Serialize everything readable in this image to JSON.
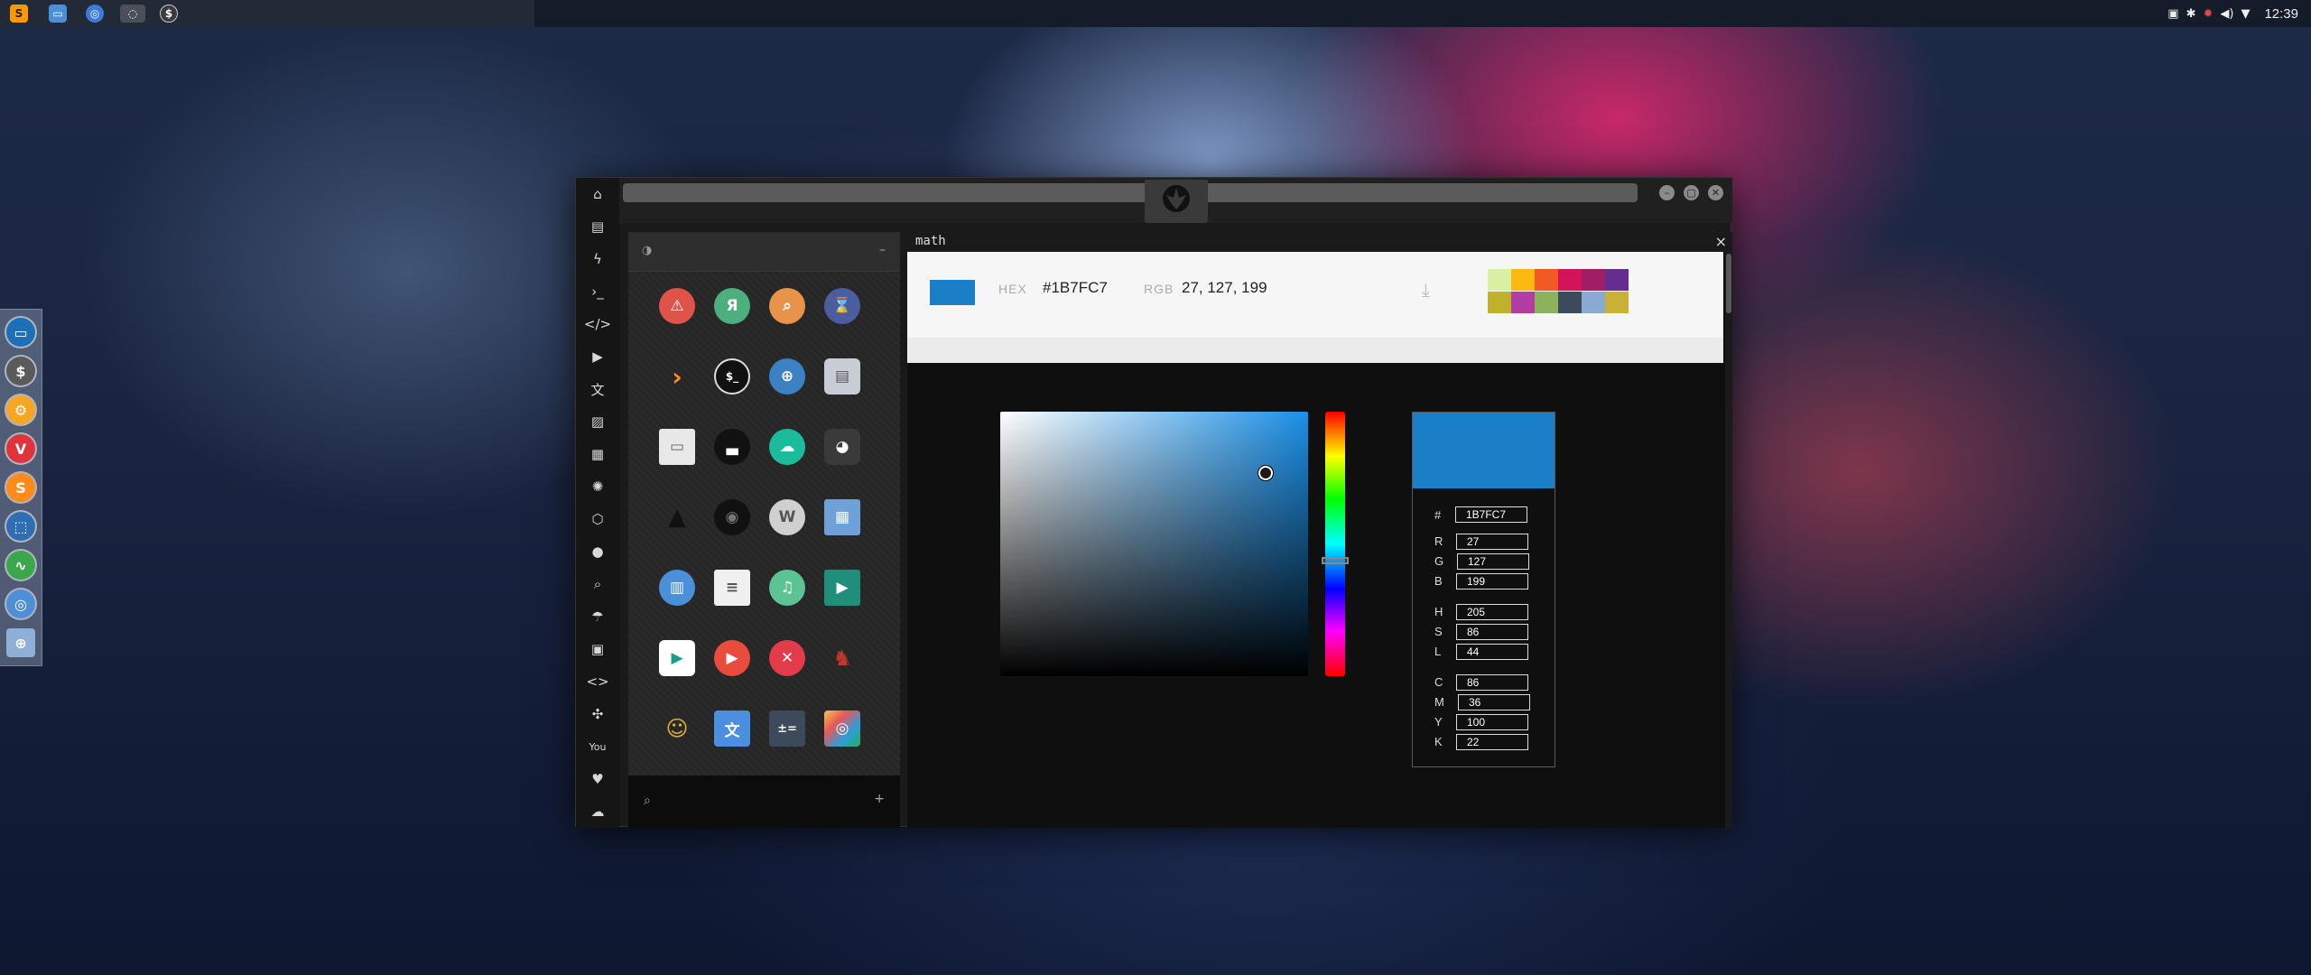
{
  "topbar": {
    "clock": "12:39",
    "taskbar_icons": [
      "sublime-text-icon",
      "file-manager-icon",
      "chromium-icon",
      "app-icon",
      "terminal-icon"
    ]
  },
  "dock": {
    "icons": [
      "files-icon",
      "dollar-terminal-icon",
      "settings-icon",
      "vivaldi-icon",
      "sublime-icon",
      "screenshot-icon",
      "system-monitor-icon",
      "chrome-icon",
      "globe-icon"
    ]
  },
  "window": {
    "tab_title": "math",
    "close_glyph": "×",
    "apps_panel": {
      "collapse_glyph": "–",
      "add_glyph": "+",
      "apps": [
        "warning-icon",
        "yandex-icon",
        "search-icon",
        "hourglass-icon",
        "prompt-icon",
        "terminal-icon",
        "globe-icon",
        "storage-icon",
        "window-icon",
        "barcode-icon",
        "cloud-icon",
        "github-icon",
        "starfleet-icon",
        "death-star-icon",
        "wiki-icon",
        "map-icon",
        "archive-icon",
        "document-icon",
        "music-icon",
        "video-icon",
        "play-icon",
        "youtube-icon",
        "close-icon",
        "ironman-icon",
        "c3po-icon",
        "translate-icon",
        "calculator-icon",
        "photo-icon"
      ]
    },
    "picker": {
      "hex_label": "HEX",
      "hex_value": "#1B7FC7",
      "rgb_label": "RGB",
      "rgb_value": "27, 127, 199",
      "current_color": "#1B7FC7",
      "palette": [
        "#d9f0a3",
        "#fdb813",
        "#f15a24",
        "#d4145a",
        "#9e1f63",
        "#662d91",
        "#bfb12c",
        "#b23ea3",
        "#8cb35c",
        "#3d4a5c",
        "#8aaad4",
        "#c9b037"
      ],
      "fields": {
        "hash_label": "#",
        "hex": "1B7FC7",
        "r_label": "R",
        "r": "27",
        "g_label": "G",
        "g": "127",
        "b_label": "B",
        "b": "199",
        "h_label": "H",
        "h": "205",
        "s_label": "S",
        "s": "86",
        "l_label": "L",
        "l": "44",
        "c_label": "C",
        "c": "86",
        "m_label": "M",
        "m": "36",
        "y_label": "Y",
        "y": "100",
        "k_label": "K",
        "k": "22"
      }
    }
  }
}
